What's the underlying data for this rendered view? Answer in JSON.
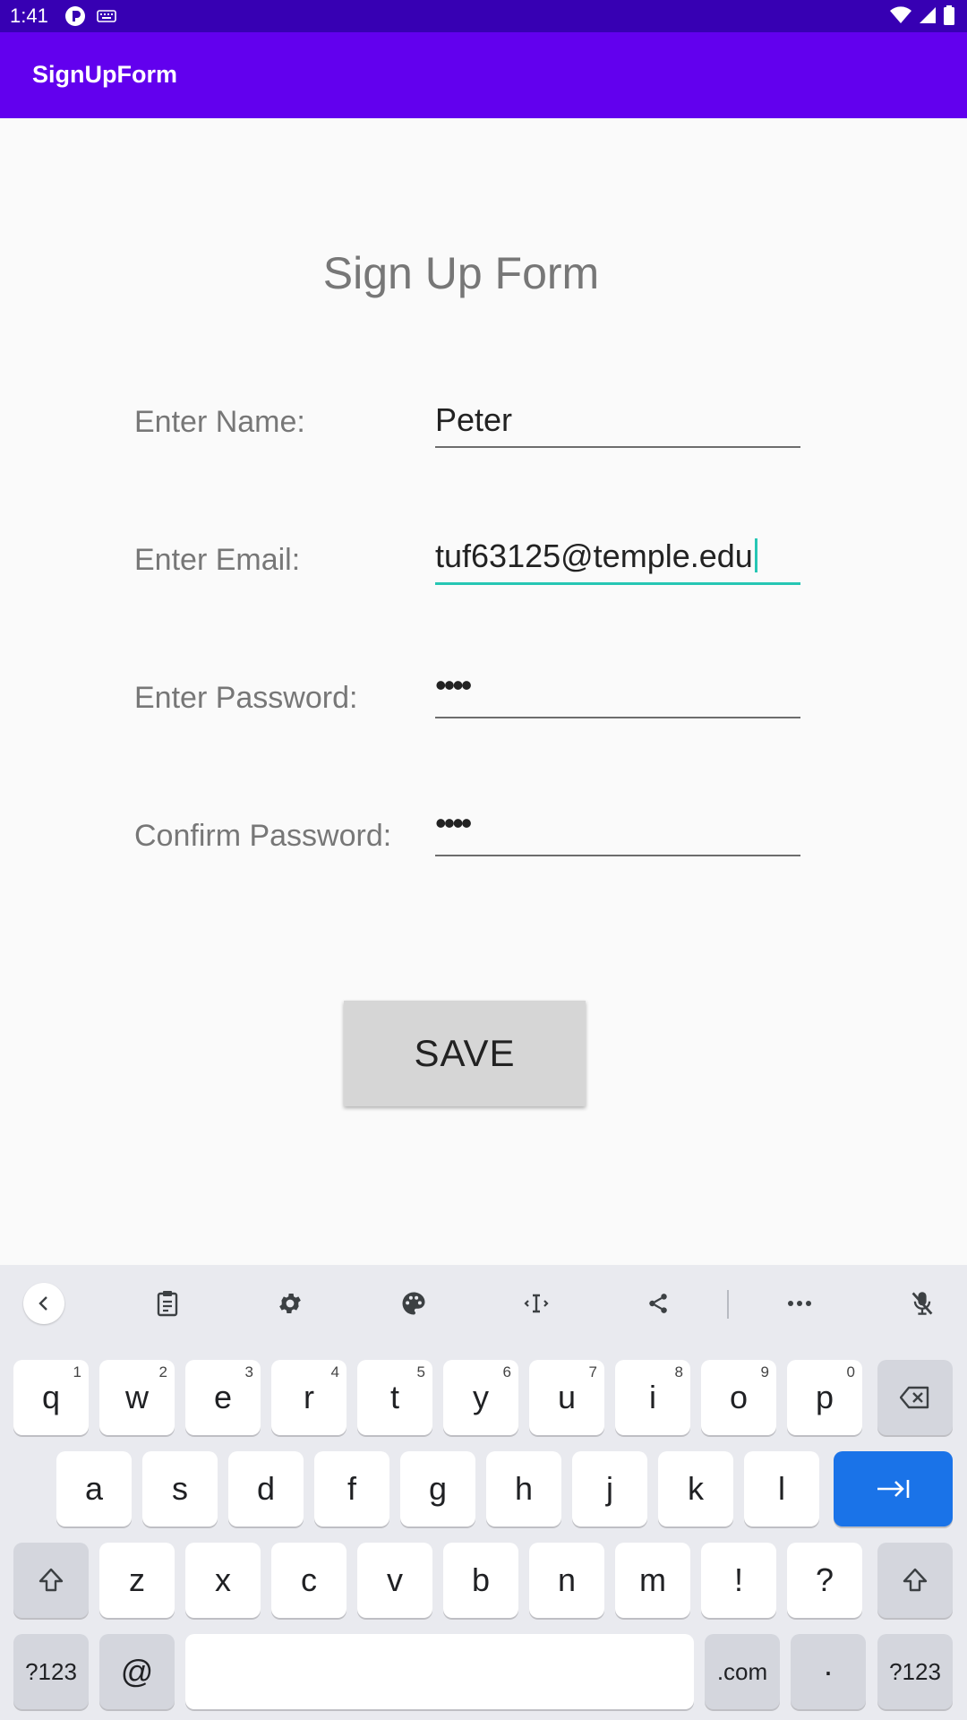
{
  "status_bar": {
    "time": "1:41"
  },
  "app_bar": {
    "title": "SignUpForm"
  },
  "form": {
    "title": "Sign Up Form",
    "name_label": "Enter Name:",
    "name_value": "Peter",
    "email_label": "Enter Email:",
    "email_value": "tuf63125@temple.edu",
    "password_label": "Enter Password:",
    "password_value": "••••",
    "confirm_label": "Confirm Password:",
    "confirm_value": "••••",
    "save_label": "SAVE"
  },
  "keyboard": {
    "row1": [
      {
        "k": "q",
        "h": "1"
      },
      {
        "k": "w",
        "h": "2"
      },
      {
        "k": "e",
        "h": "3"
      },
      {
        "k": "r",
        "h": "4"
      },
      {
        "k": "t",
        "h": "5"
      },
      {
        "k": "y",
        "h": "6"
      },
      {
        "k": "u",
        "h": "7"
      },
      {
        "k": "i",
        "h": "8"
      },
      {
        "k": "o",
        "h": "9"
      },
      {
        "k": "p",
        "h": "0"
      }
    ],
    "row2": [
      "a",
      "s",
      "d",
      "f",
      "g",
      "h",
      "j",
      "k",
      "l"
    ],
    "row3": [
      "z",
      "x",
      "c",
      "v",
      "b",
      "n",
      "m",
      "!",
      "?"
    ],
    "symbols_label": "?123",
    "at_label": "@",
    "dotcom_label": ".com",
    "period_label": "·",
    "symbols_label_right": "?123"
  },
  "colors": {
    "status_bar": "#3700b3",
    "app_bar": "#6200ee",
    "focus_accent": "#26c6b4",
    "keyboard_action": "#1a73e8"
  }
}
